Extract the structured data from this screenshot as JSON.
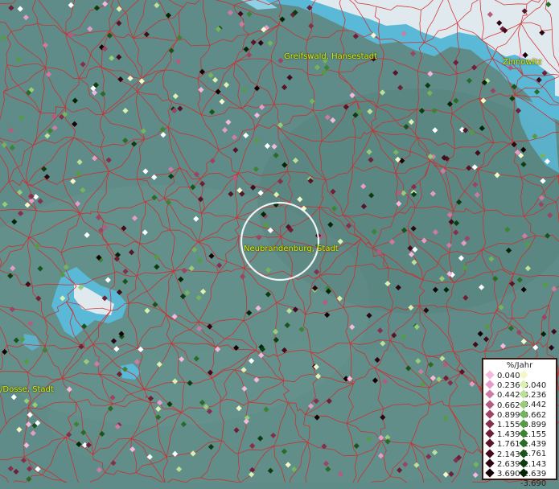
{
  "map": {
    "labels": {
      "greifswald": "Greifswald, Hansestadt",
      "zinnowitz": "Zinnowitz",
      "neubrandenburg": "Neubrandenburg, Stadt",
      "dosse": "/Dosse, Stadt"
    },
    "colors": {
      "land": "#5f8c88",
      "water": "#5ab9d6",
      "coast_land": "#dfe9ee",
      "boundaries": "#d42828",
      "selection_ring": "#ffffff"
    }
  },
  "legend": {
    "title": "%/Jahr",
    "positive": [
      {
        "label": "0.040",
        "color": "#f4b8dc"
      },
      {
        "label": "0.236",
        "color": "#e59cc8"
      },
      {
        "label": "0.442",
        "color": "#cc7ca4"
      },
      {
        "label": "0.662",
        "color": "#b35c80"
      },
      {
        "label": "0.899",
        "color": "#9c4464"
      },
      {
        "label": "1.155",
        "color": "#84304c"
      },
      {
        "label": "1.439",
        "color": "#6e2038"
      },
      {
        "label": "1.761",
        "color": "#581428"
      },
      {
        "label": "2.143",
        "color": "#420c1c"
      },
      {
        "label": "2.639",
        "color": "#2c0610"
      },
      {
        "label": "3.690",
        "color": "#150204"
      }
    ],
    "negative": [
      {
        "label": "-0.040",
        "color": "#f4f8c8"
      },
      {
        "label": "-0.236",
        "color": "#dcf0b0"
      },
      {
        "label": "-0.442",
        "color": "#bce098"
      },
      {
        "label": "-0.662",
        "color": "#98cc78"
      },
      {
        "label": "-0.899",
        "color": "#74b45c"
      },
      {
        "label": "-1.155",
        "color": "#549c44"
      },
      {
        "label": "-1.439",
        "color": "#3c8434"
      },
      {
        "label": "-1.761",
        "color": "#286c28"
      },
      {
        "label": "-2.143",
        "color": "#18541c"
      },
      {
        "label": "-2.639",
        "color": "#0c3c10"
      },
      {
        "label": "-3.690",
        "color": "#042406"
      }
    ]
  }
}
